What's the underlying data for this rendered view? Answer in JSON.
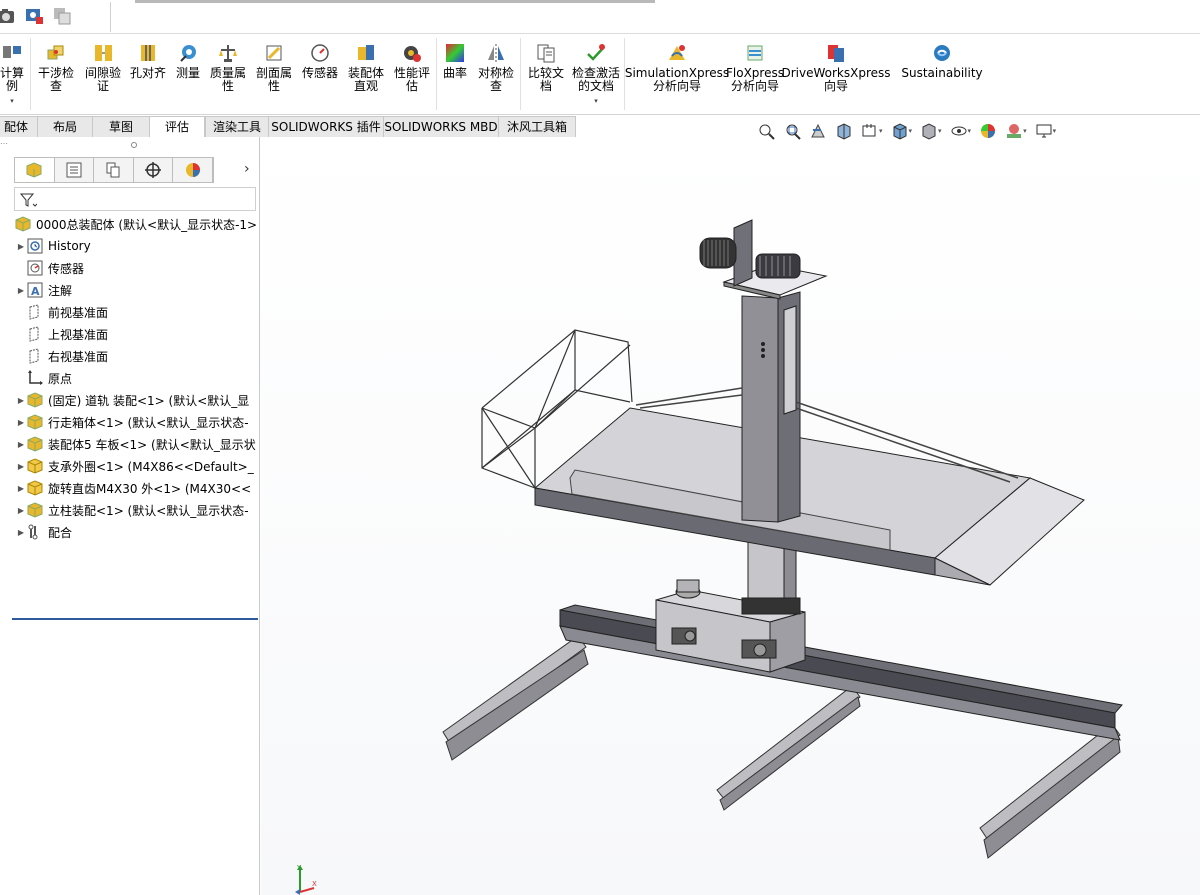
{
  "ribbon": {
    "items": [
      {
        "label": "计算\n例",
        "icon": "calc-icon"
      },
      {
        "label": "干涉检\n查",
        "icon": "interference-icon"
      },
      {
        "label": "间隙验\n证",
        "icon": "clearance-icon"
      },
      {
        "label": "孔对齐",
        "icon": "hole-align-icon"
      },
      {
        "label": "测量",
        "icon": "measure-icon"
      },
      {
        "label": "质量属\n性",
        "icon": "mass-props-icon"
      },
      {
        "label": "剖面属\n性",
        "icon": "section-props-icon"
      },
      {
        "label": "传感器",
        "icon": "sensor-icon"
      },
      {
        "label": "装配体\n直观",
        "icon": "assembly-visual-icon"
      },
      {
        "label": "性能评\n估",
        "icon": "performance-icon"
      },
      {
        "label": "曲率",
        "icon": "curvature-icon"
      },
      {
        "label": "对称检\n查",
        "icon": "symmetry-icon"
      },
      {
        "label": "比较文\n档",
        "icon": "compare-icon"
      },
      {
        "label": "检查激活\n的文档",
        "icon": "check-doc-icon"
      },
      {
        "label": "SimulationXpress\n分析向导",
        "icon": "simulationxpress-icon"
      },
      {
        "label": "FloXpress\n分析向导",
        "icon": "floxpress-icon"
      },
      {
        "label": "DriveWorksXpress\n向导",
        "icon": "driveworks-icon"
      },
      {
        "label": "Sustainability",
        "icon": "sustainability-icon"
      }
    ]
  },
  "tabs": [
    {
      "label": "装配体",
      "visible": "配体"
    },
    {
      "label": "布局"
    },
    {
      "label": "草图"
    },
    {
      "label": "评估",
      "active": true
    },
    {
      "label": "渲染工具"
    },
    {
      "label": "SOLIDWORKS 插件"
    },
    {
      "label": "SOLIDWORKS MBD"
    },
    {
      "label": "沐风工具箱"
    }
  ],
  "tree": {
    "root": "0000总装配体  (默认<默认_显示状态-1>",
    "items": [
      {
        "label": "History",
        "icon": "history-icon",
        "expand": true
      },
      {
        "label": "传感器",
        "icon": "sensor-icon",
        "expand": false
      },
      {
        "label": "注解",
        "icon": "annotation-icon",
        "expand": true
      },
      {
        "label": "前视基准面",
        "icon": "plane-icon",
        "expand": false
      },
      {
        "label": "上视基准面",
        "icon": "plane-icon",
        "expand": false
      },
      {
        "label": "右视基准面",
        "icon": "plane-icon",
        "expand": false
      },
      {
        "label": "原点",
        "icon": "origin-icon",
        "expand": false
      },
      {
        "label": "(固定) 道轨 装配<1> (默认<默认_显",
        "icon": "assembly-icon",
        "expand": true
      },
      {
        "label": "行走箱体<1> (默认<默认_显示状态-",
        "icon": "assembly-icon",
        "expand": true
      },
      {
        "label": "装配体5 车板<1> (默认<默认_显示状",
        "icon": "assembly-icon",
        "expand": true
      },
      {
        "label": "支承外圈<1> (M4X86<<Default>_",
        "icon": "part-icon",
        "expand": true
      },
      {
        "label": "旋转直齿M4X30 外<1> (M4X30<<",
        "icon": "part-icon",
        "expand": true
      },
      {
        "label": "立柱装配<1> (默认<默认_显示状态-",
        "icon": "assembly-icon",
        "expand": true
      },
      {
        "label": "配合",
        "icon": "mates-icon",
        "expand": true
      }
    ]
  },
  "viewport": {
    "triad": {
      "y": "Y",
      "x": "X"
    }
  },
  "colors": {
    "tab_active": "#ffffff",
    "tab_inactive": "#e8e8e8",
    "tree_accent": "#2e5a9c",
    "steel": "#8f8f95",
    "steel_light": "#c8c8cc"
  }
}
